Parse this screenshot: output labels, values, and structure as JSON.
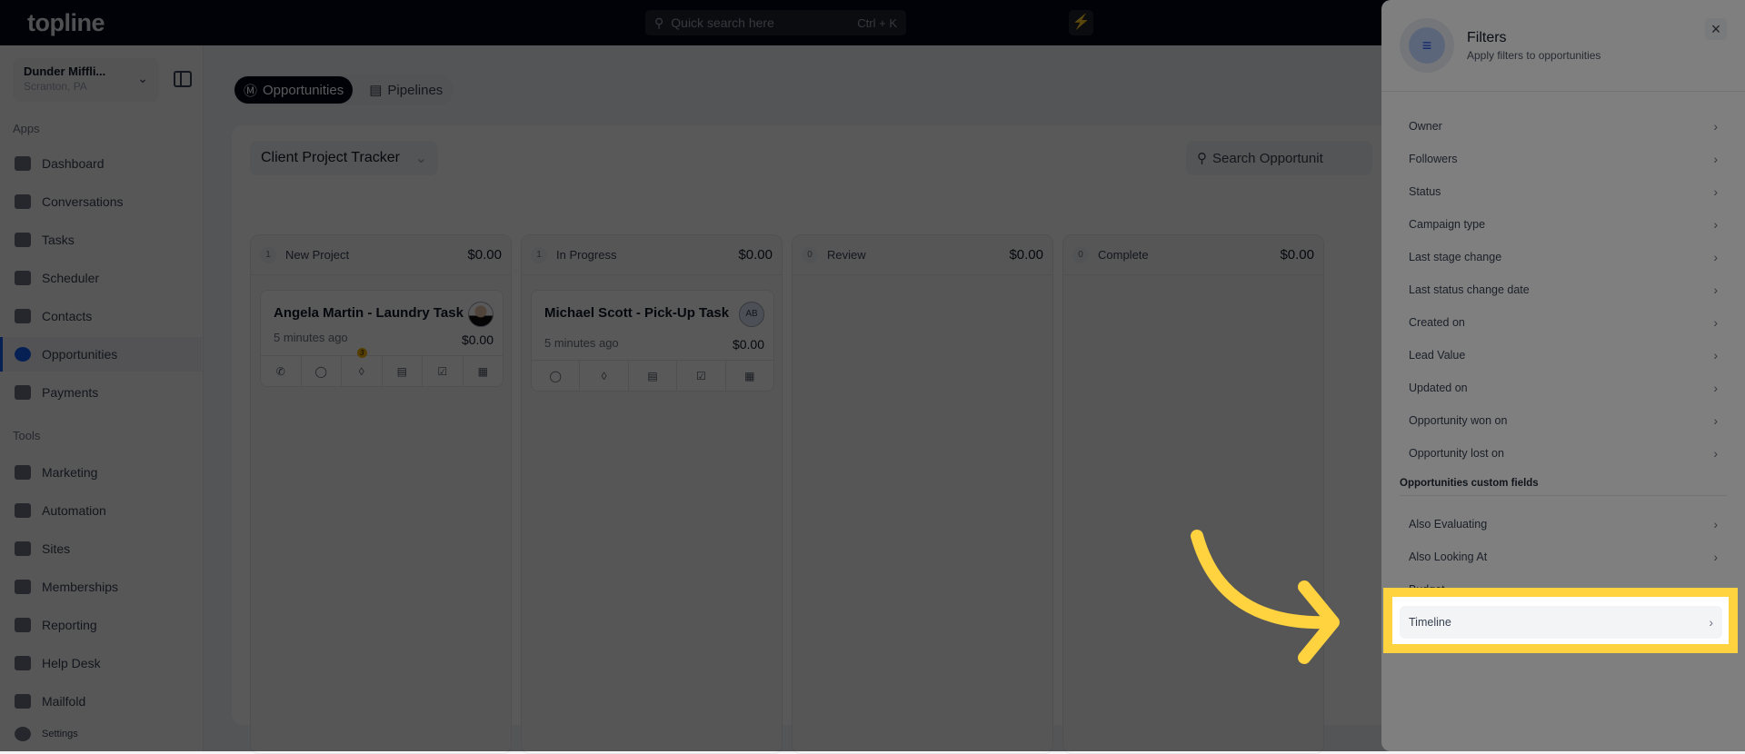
{
  "topbar": {
    "logo": "topline",
    "search_placeholder": "Quick search here",
    "search_shortcut": "Ctrl + K"
  },
  "sidebar": {
    "workspace_name": "Dunder Miffli...",
    "workspace_location": "Scranton, PA",
    "apps_label": "Apps",
    "apps": [
      {
        "label": "Dashboard",
        "icon": "dashboard-icon"
      },
      {
        "label": "Conversations",
        "icon": "chat-icon"
      },
      {
        "label": "Tasks",
        "icon": "task-icon"
      },
      {
        "label": "Scheduler",
        "icon": "calendar-icon"
      },
      {
        "label": "Contacts",
        "icon": "user-icon"
      },
      {
        "label": "Opportunities",
        "icon": "target-icon",
        "active": true
      },
      {
        "label": "Payments",
        "icon": "card-icon"
      }
    ],
    "tools_label": "Tools",
    "tools": [
      {
        "label": "Marketing",
        "icon": "megaphone-icon"
      },
      {
        "label": "Automation",
        "icon": "gears-icon"
      },
      {
        "label": "Sites",
        "icon": "globe-icon"
      },
      {
        "label": "Memberships",
        "icon": "users-icon"
      },
      {
        "label": "Reporting",
        "icon": "pie-icon"
      },
      {
        "label": "Help Desk",
        "icon": "help-icon"
      },
      {
        "label": "Mailfold",
        "icon": "mail-icon"
      }
    ],
    "settings_label": "Settings"
  },
  "main": {
    "tabs": [
      {
        "label": "Opportunities",
        "active": true
      },
      {
        "label": "Pipelines"
      }
    ],
    "pipeline": "Client Project Tracker",
    "search_placeholder": "Search Opportunit",
    "columns": [
      {
        "count": "1",
        "name": "New Project",
        "amount": "$0.00"
      },
      {
        "count": "1",
        "name": "In Progress",
        "amount": "$0.00"
      },
      {
        "count": "0",
        "name": "Review",
        "amount": "$0.00"
      },
      {
        "count": "0",
        "name": "Complete",
        "amount": "$0.00"
      }
    ],
    "cards": [
      {
        "title": "Angela Martin - Laundry Task",
        "time": "5 minutes ago",
        "value": "$0.00",
        "tag_badge": "3"
      },
      {
        "title": "Michael Scott - Pick-Up Task",
        "time": "5 minutes ago",
        "value": "$0.00",
        "avatar": "AB"
      }
    ]
  },
  "filters": {
    "title": "Filters",
    "subtitle": "Apply filters to opportunities",
    "items": [
      "Owner",
      "Followers",
      "Status",
      "Campaign type",
      "Last stage change",
      "Last status change date",
      "Created on",
      "Lead Value",
      "Updated on",
      "Opportunity won on",
      "Opportunity lost on"
    ],
    "custom_label": "Opportunities custom fields",
    "custom_items": [
      "Also Evaluating",
      "Also Looking At",
      "Budget",
      "Timeline"
    ]
  },
  "colors": {
    "highlight": "#ffd23f",
    "accent": "#155eef",
    "topbar": "#020617"
  }
}
